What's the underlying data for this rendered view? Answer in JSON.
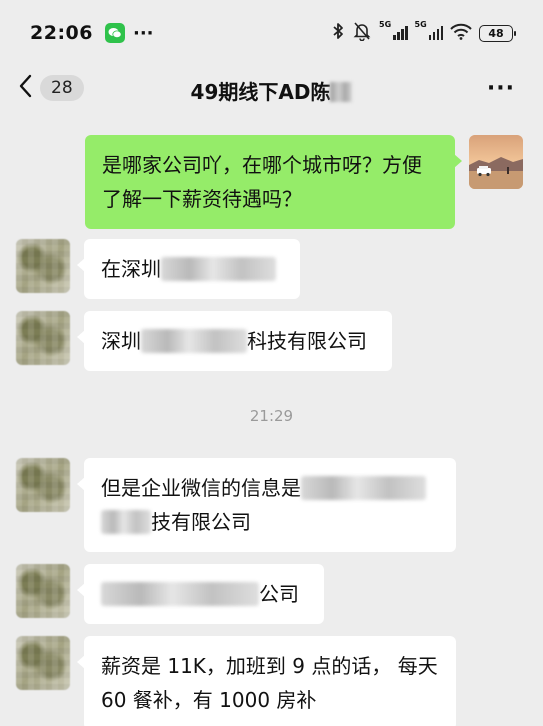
{
  "status_bar": {
    "time": "22:06",
    "more": "···",
    "sim1_label": "5G",
    "sim2_label": "5G",
    "battery": "48"
  },
  "nav": {
    "unread_count": "28",
    "title": "49期线下AD陈",
    "more": "···"
  },
  "messages": [
    {
      "id": "m1",
      "side": "out",
      "text": "是哪家公司吖，在哪个城市呀？方便了解一下薪资待遇吗？"
    },
    {
      "id": "m2",
      "side": "in",
      "text_before": "在深圳",
      "text_after": ""
    },
    {
      "id": "m3",
      "side": "in",
      "text_before": "深圳",
      "text_after": "科技有限公司"
    },
    {
      "id": "m4",
      "side": "in",
      "line1": "但是企业微信的信息是",
      "line2_after": "技有限公司"
    },
    {
      "id": "m5",
      "side": "in",
      "text_after": "公司"
    },
    {
      "id": "m6",
      "side": "in",
      "text": "薪资是 11K，加班到 9 点的话， 每天 60 餐补，有 1000 房补"
    }
  ],
  "time_divider": "21:29",
  "colors": {
    "background": "#ededed",
    "outgoing_bubble": "#95ec69",
    "incoming_bubble": "#ffffff",
    "app_badge": "#2fc24b"
  }
}
